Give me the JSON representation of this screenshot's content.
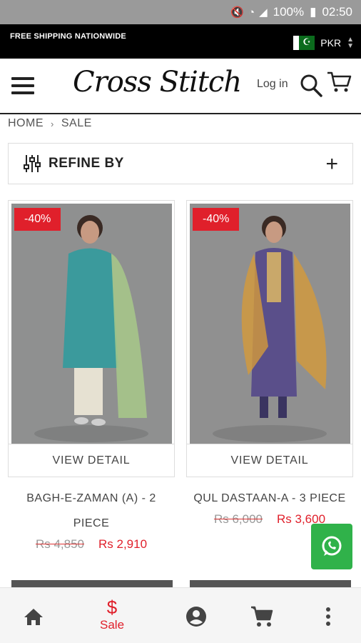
{
  "status_bar": {
    "battery": "100%",
    "time": "02:50"
  },
  "top_bar": {
    "shipping": "FREE SHIPPING NATIONWIDE",
    "currency": "PKR"
  },
  "header": {
    "logo": "Cross Stitch",
    "login": "Log in"
  },
  "breadcrumb": {
    "home": "HOME",
    "separator": "›",
    "current": "SALE"
  },
  "refine": {
    "label": "REFINE BY",
    "expand": "+"
  },
  "products": [
    {
      "badge": "-40%",
      "view": "VIEW DETAIL",
      "name": "BAGH-E-ZAMAN (A) - 2 PIECE",
      "old_price": "Rs 4,850",
      "new_price": "Rs 2,910"
    },
    {
      "badge": "-40%",
      "view": "VIEW DETAIL",
      "name": "QUL DASTAAN-A - 3 PIECE",
      "old_price": "Rs 6,000",
      "new_price": "Rs 3,600"
    }
  ],
  "bottom_nav": {
    "sale_symbol": "$",
    "sale_label": "Sale"
  },
  "colors": {
    "accent": "#e0202b",
    "whatsapp": "#30b24a",
    "topbar": "#000000"
  }
}
